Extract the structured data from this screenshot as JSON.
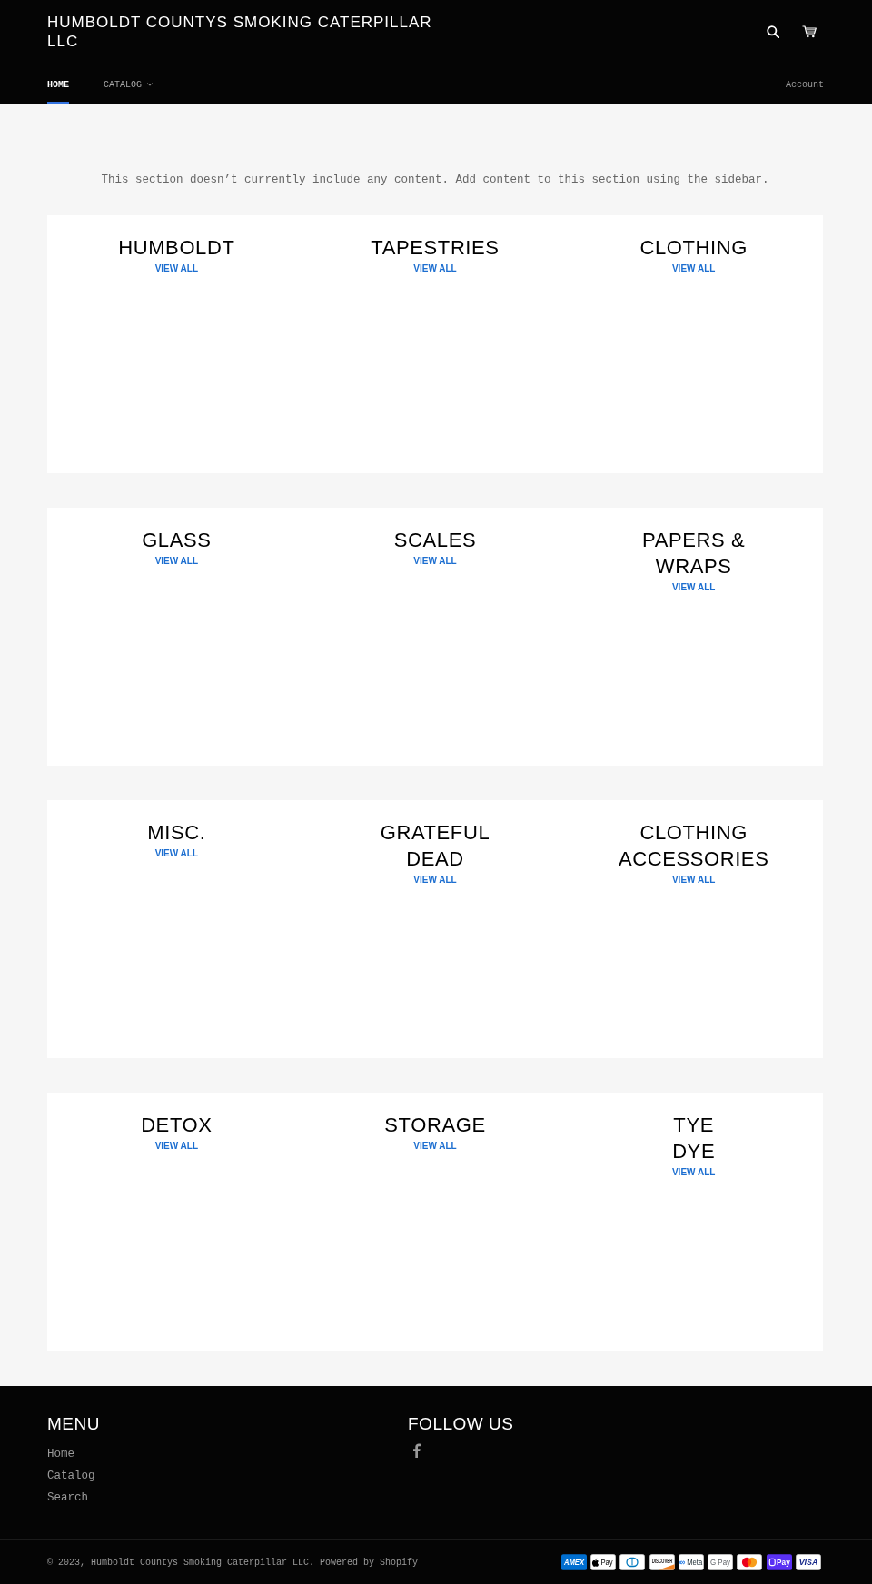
{
  "header": {
    "title": "HUMBOLDT COUNTYS SMOKING CATERPILLAR LLC"
  },
  "nav": {
    "items": [
      {
        "label": "HOME",
        "selected": true,
        "dropdown": false
      },
      {
        "label": "CATALOG",
        "selected": false,
        "dropdown": true
      }
    ],
    "account": "Account"
  },
  "intro": "This section doesn’t currently include any content. Add content to this section using the sidebar.",
  "collection_rows": [
    [
      {
        "title": "HUMBOLDT",
        "link": "VIEW ALL"
      },
      {
        "title": "TAPESTRIES",
        "link": "VIEW ALL"
      },
      {
        "title": "CLOTHING",
        "link": "VIEW ALL"
      }
    ],
    [
      {
        "title": "GLASS",
        "link": "VIEW ALL"
      },
      {
        "title": "SCALES",
        "link": "VIEW ALL"
      },
      {
        "title": "PAPERS & WRAPS",
        "link": "VIEW ALL"
      }
    ],
    [
      {
        "title": "MISC.",
        "link": "VIEW ALL"
      },
      {
        "title": "GRATEFUL DEAD",
        "link": "VIEW ALL"
      },
      {
        "title": "CLOTHING ACCESSORIES",
        "link": "VIEW ALL"
      }
    ],
    [
      {
        "title": "DETOX",
        "link": "VIEW ALL"
      },
      {
        "title": "STORAGE",
        "link": "VIEW ALL"
      },
      {
        "title": "TYE\nDYE",
        "link": "VIEW ALL"
      }
    ]
  ],
  "footer": {
    "menu": {
      "heading": "MENU",
      "links": [
        "Home",
        "Catalog",
        "Search"
      ]
    },
    "follow": {
      "heading": "FOLLOW US"
    },
    "copyright": "© 2023, Humboldt Countys Smoking Caterpillar LLC. Powered by Shopify",
    "payment_icons": [
      {
        "kind": "amex",
        "label": "AMEX"
      },
      {
        "kind": "apple_pay",
        "label": "Pay"
      },
      {
        "kind": "diners"
      },
      {
        "kind": "discover",
        "label": "DISCOVER"
      },
      {
        "kind": "meta_pay",
        "label": "Meta"
      },
      {
        "kind": "google_pay",
        "label": "G Pay"
      },
      {
        "kind": "mastercard"
      },
      {
        "kind": "shop_pay",
        "label": "Pay"
      },
      {
        "kind": "visa",
        "label": "VISA"
      }
    ]
  }
}
